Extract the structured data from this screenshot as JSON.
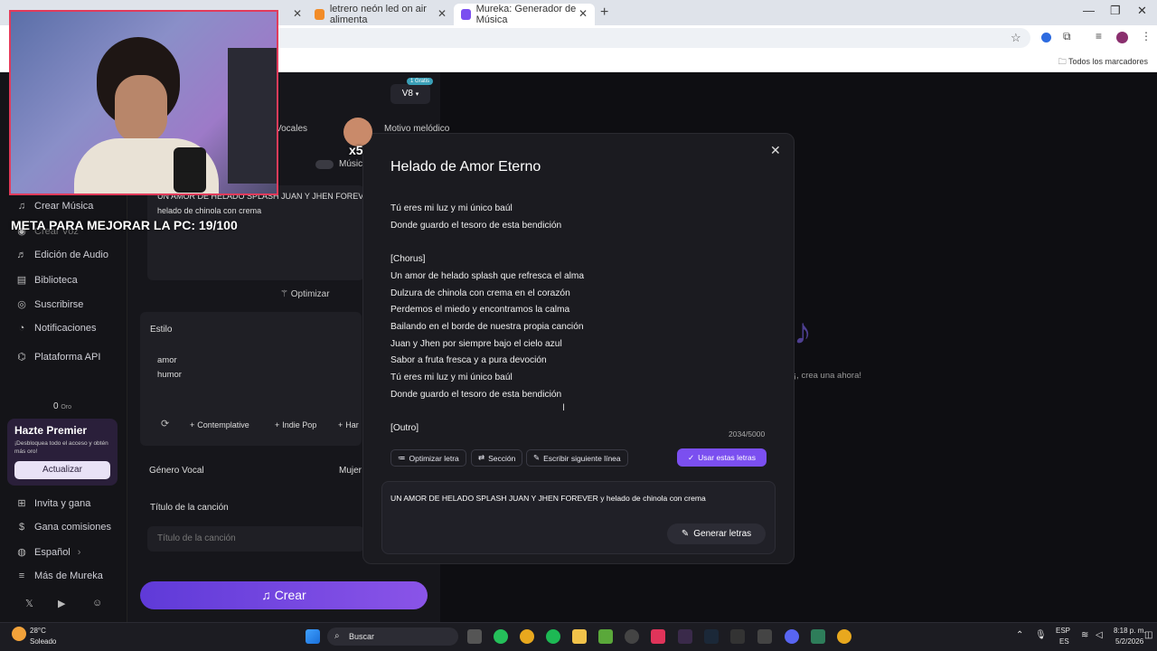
{
  "browser": {
    "tabs": [
      {
        "label": "",
        "active": false
      },
      {
        "label": "letrero neón led on air alimenta",
        "active": false
      },
      {
        "label": "Mureka: Generador de Música",
        "active": true
      }
    ],
    "bookmarks_all": "Todos los marcadores"
  },
  "overlay": {
    "meta_text": "META PARA MEJORAR LA PC: 19/100",
    "x5": "x5"
  },
  "sidebar": {
    "items": [
      {
        "label": "Crear Música",
        "icon": "music-icon"
      },
      {
        "label": "Crear Voz",
        "icon": "mic-icon"
      },
      {
        "label": "Edición de Audio",
        "icon": "audio-icon"
      },
      {
        "label": "Biblioteca",
        "icon": "library-icon"
      },
      {
        "label": "Suscribirse",
        "icon": "subscribe-icon"
      },
      {
        "label": "Notificaciones",
        "icon": "bell-icon"
      },
      {
        "label": "Plataforma API",
        "icon": "api-icon"
      }
    ],
    "credits": "0",
    "credits_unit": "Oro",
    "premium_title": "Hazte Premier",
    "premium_desc": "¡Desbloquea todo el acceso y obtén más oro!",
    "premium_button": "Actualizar",
    "bottom_items": [
      {
        "label": "Invita y gana",
        "icon": "gift-icon"
      },
      {
        "label": "Gana comisiones",
        "icon": "dollar-icon"
      },
      {
        "label": "Español",
        "icon": "globe-icon"
      },
      {
        "label": "Más de Mureka",
        "icon": "menu-icon"
      }
    ]
  },
  "main": {
    "version": "V8",
    "version_badge": "1 Gratis",
    "tab_vocales": "Vocales",
    "tab_melodic": "Motivo melódico",
    "music_toggle": "Músic",
    "lyrics_line1": "UN AMOR DE HELADO SPLASH JUAN Y JHEN FOREVER",
    "lyrics_line2": "helado de chinola con crema",
    "optimize": "Optimizar",
    "style_label": "Estilo",
    "style_values": [
      "amor",
      "humor"
    ],
    "chips": [
      "Contemplative",
      "Indie Pop",
      "Har"
    ],
    "vocal_label": "Género Vocal",
    "vocal_value": "Mujer",
    "title_label": "Título de la canción",
    "title_placeholder": "Título de la canción",
    "create_button": "Crear",
    "right_hint": "¡, crea una ahora!"
  },
  "modal": {
    "title": "Helado de Amor Eterno",
    "lyrics": [
      "Tú eres mi luz y mi único baúl",
      "Donde guardo el tesoro de esta bendición",
      "",
      "[Chorus]",
      "Un amor de helado splash que refresca el alma",
      "Dulzura de chinola con crema en el corazón",
      "Perdemos el miedo y encontramos la calma",
      "Bailando en el borde de nuestra propia canción",
      "Juan y Jhen por siempre bajo el cielo azul",
      "Sabor a fruta fresca y a pura devoción",
      "Tú eres mi luz y mi único baúl",
      "Donde guardo el tesoro de esta bendición",
      "",
      "[Outro]"
    ],
    "char_count": "2034/5000",
    "btn_optimize": "Optimizar letra",
    "btn_section": "Sección",
    "btn_next_line": "Escribir siguiente línea",
    "btn_use": "Usar estas letras",
    "prompt_text": "UN AMOR DE HELADO SPLASH JUAN Y JHEN FOREVER y helado de chinola con crema",
    "btn_generate": "Generar letras"
  },
  "taskbar": {
    "weather_temp": "28°C",
    "weather_desc": "Soleado",
    "search": "Buscar",
    "lang1": "ESP",
    "lang2": "ES",
    "time": "8:18 p. m.",
    "date": "5/2/2026"
  },
  "colors": {
    "accent": "#7b4ff0",
    "create_gradient_start": "#5f3ad8",
    "webcam_border": "#e23b5b"
  }
}
